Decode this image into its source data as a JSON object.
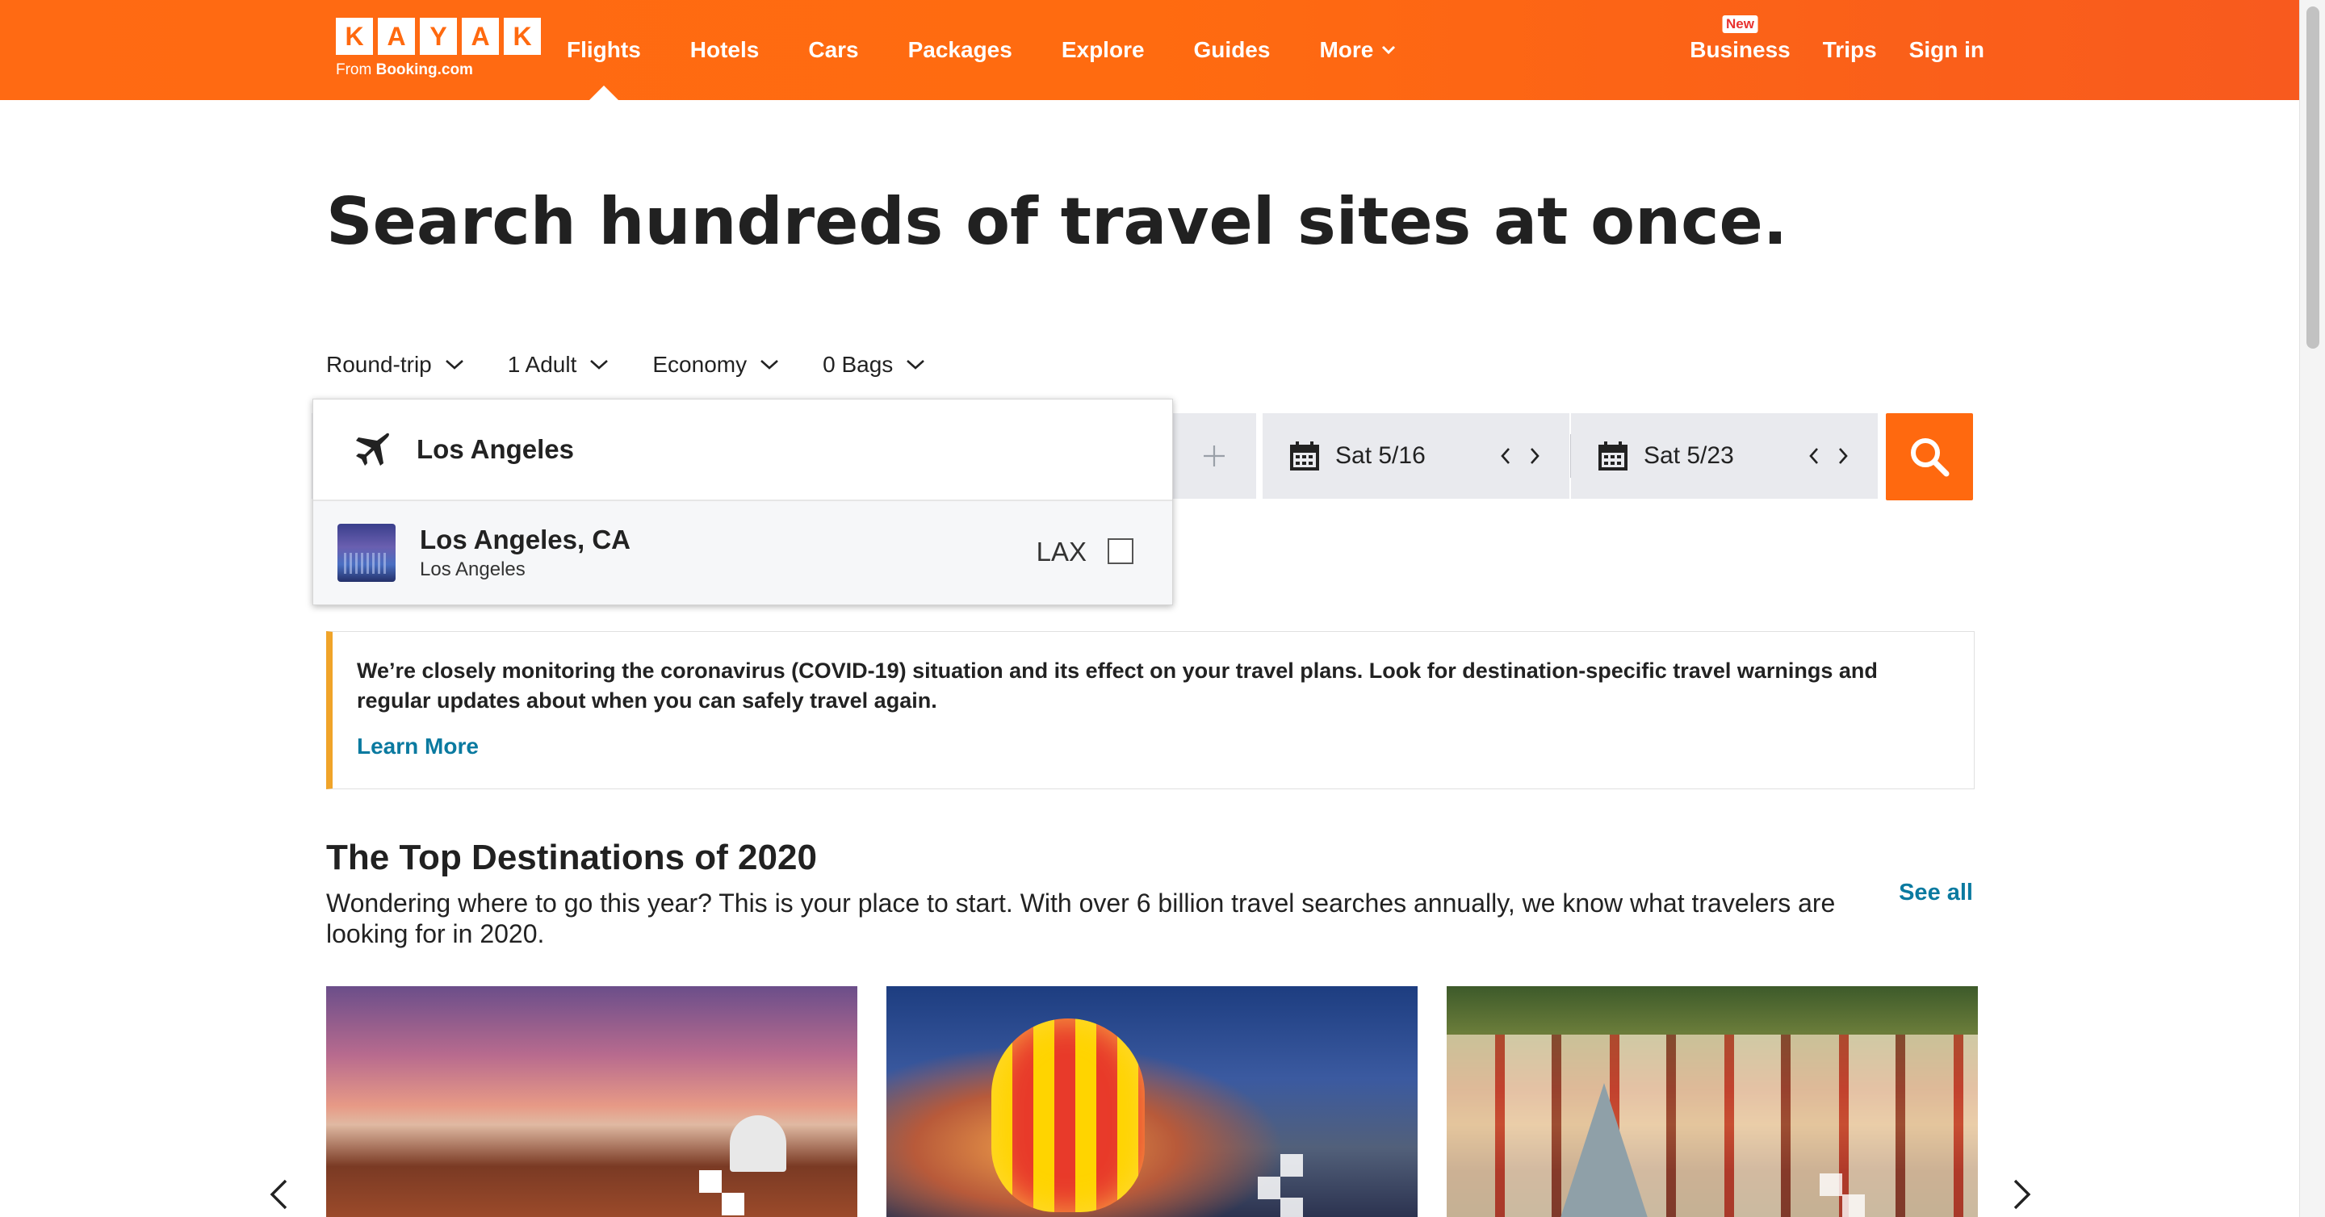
{
  "header": {
    "logo_letters": [
      "K",
      "A",
      "Y",
      "A",
      "K"
    ],
    "logo_from": "From",
    "logo_brand": "Booking.com",
    "nav": [
      {
        "label": "Flights",
        "active": true
      },
      {
        "label": "Hotels"
      },
      {
        "label": "Cars"
      },
      {
        "label": "Packages"
      },
      {
        "label": "Explore"
      },
      {
        "label": "Guides"
      },
      {
        "label": "More",
        "has_dropdown": true
      }
    ],
    "right": {
      "business_badge": "New",
      "business": "Business",
      "trips": "Trips",
      "sign_in": "Sign in"
    },
    "colors": {
      "brand": "#ff690f"
    }
  },
  "hero": {
    "title": "Search hundreds of travel sites at once."
  },
  "search": {
    "options": {
      "trip_type": "Round-trip",
      "travelers": "1 Adult",
      "cabin": "Economy",
      "bags": "0 Bags"
    },
    "origin_query": "Los Angeles",
    "depart_date": "Sat 5/16",
    "return_date": "Sat 5/23",
    "autocomplete": {
      "results": [
        {
          "city": "Los Angeles, CA",
          "sub": "Los Angeles",
          "code": "LAX",
          "checked": false
        }
      ]
    }
  },
  "notice": {
    "body": "We’re closely monitoring the coronavirus (COVID-19) situation and its effect on your travel plans. Look for destination-specific travel warnings and regular updates about when you can safely travel again.",
    "link": "Learn More",
    "accent": "#f0a429"
  },
  "destinations": {
    "title": "The Top Destinations of 2020",
    "description": "Wondering where to go this year? This is your place to start. With over 6 billion travel searches annually, we know what travelers are looking for in 2020.",
    "see_all": "See all"
  }
}
